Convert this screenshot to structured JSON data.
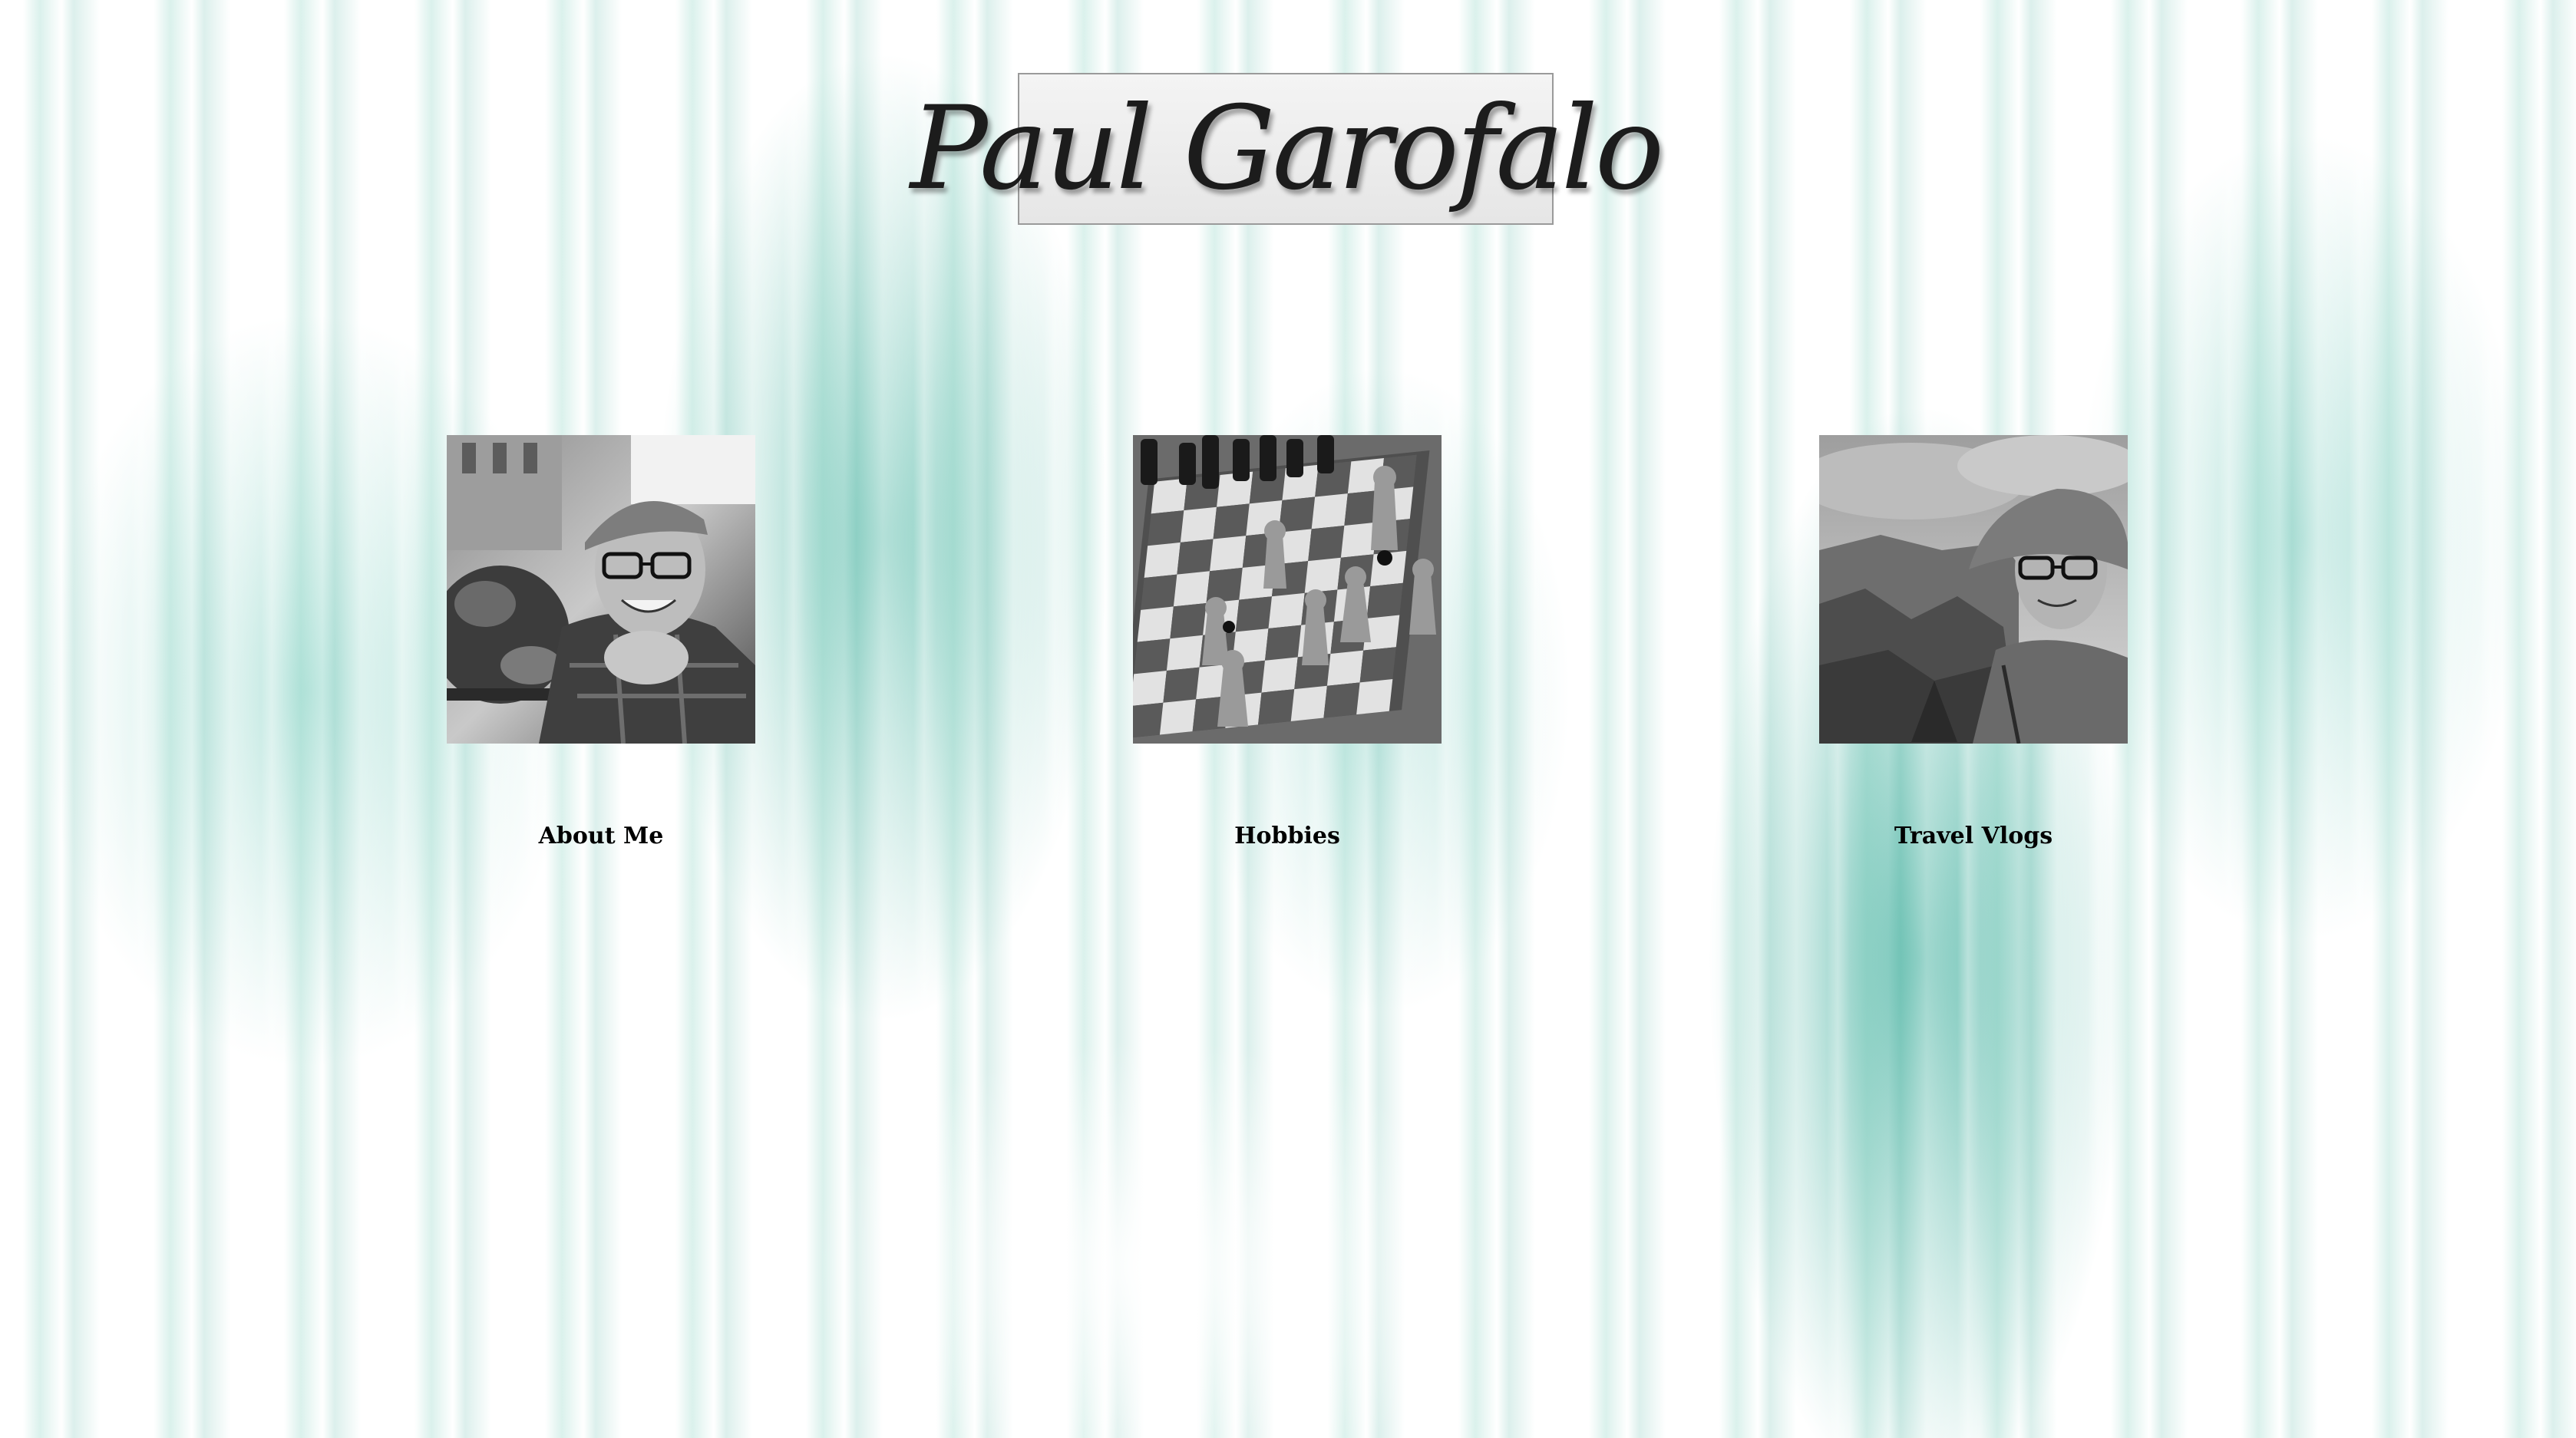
{
  "site": {
    "logo_text": "Paul Garofalo"
  },
  "cards": [
    {
      "label": "About Me",
      "image": "portrait-smiling-cap-plaid-shirt"
    },
    {
      "label": "Hobbies",
      "image": "chessboard-pieces"
    },
    {
      "label": "Travel Vlogs",
      "image": "portrait-bucket-hat-canyon"
    }
  ],
  "theme": {
    "accent": "#3fb09a",
    "text": "#000000",
    "logo_border": "#9a9a9a"
  }
}
